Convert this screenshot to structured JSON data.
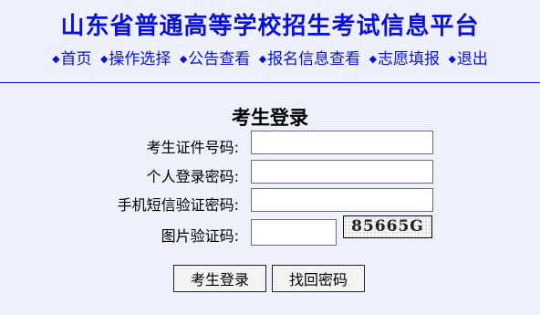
{
  "header": {
    "title": "山东省普通高等学校招生考试信息平台",
    "nav": [
      {
        "label": "首页"
      },
      {
        "label": "操作选择"
      },
      {
        "label": "公告查看"
      },
      {
        "label": "报名信息查看"
      },
      {
        "label": "志愿填报"
      },
      {
        "label": "退出"
      }
    ],
    "bullet": "◆"
  },
  "login": {
    "title": "考生登录",
    "id_label": "考生证件号码:",
    "id_value": "",
    "password_label": "个人登录密码:",
    "password_value": "",
    "sms_label": "手机短信验证密码:",
    "sms_value": "",
    "captcha_label": "图片验证码:",
    "captcha_value": "",
    "captcha_text": "85665G",
    "submit_label": "考生登录",
    "recover_label": "找回密码"
  },
  "colors": {
    "accent": "#0b12d6",
    "background": "#eef0fb"
  }
}
